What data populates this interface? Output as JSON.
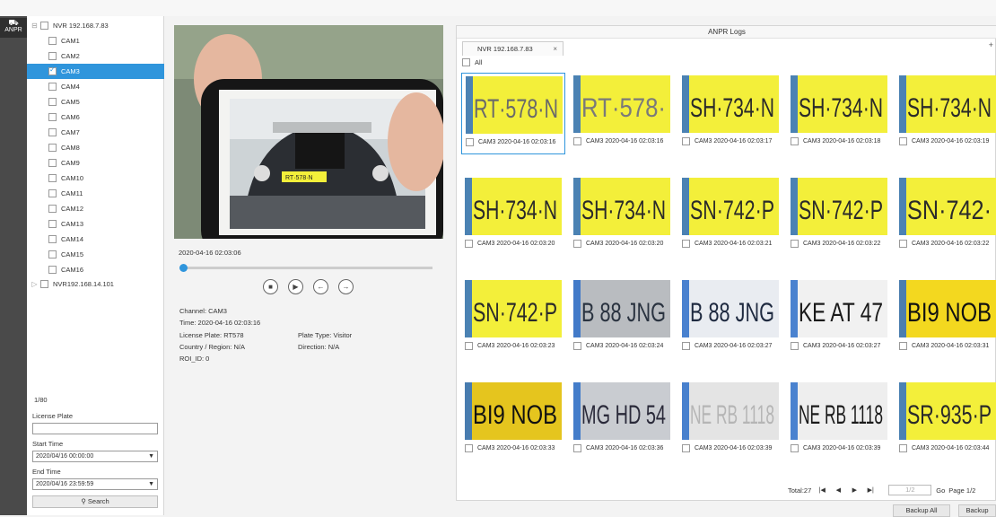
{
  "nav": {
    "label": "ANPR"
  },
  "tree": {
    "nvr1": "NVR 192.168.7.83",
    "cams": [
      "CAM1",
      "CAM2",
      "CAM3",
      "CAM4",
      "CAM5",
      "CAM6",
      "CAM7",
      "CAM8",
      "CAM9",
      "CAM10",
      "CAM11",
      "CAM12",
      "CAM13",
      "CAM14",
      "CAM15",
      "CAM16"
    ],
    "selected": "CAM3",
    "nvr2": "NVR192.168.14.101"
  },
  "pagination_left": "1/80",
  "search": {
    "plate_label": "License Plate",
    "plate_value": "",
    "start_label": "Start Time",
    "start_value": "2020/04/16 00:00:00",
    "end_label": "End Time",
    "end_value": "2020/04/16 23:59:59",
    "button": "Search"
  },
  "player": {
    "timestamp": "2020-04-16 02:03:06",
    "progress": 0.0
  },
  "details": {
    "channel": "Channel: CAM3",
    "time": "Time: 2020-04-16 02:03:16",
    "plate": "License Plate: RT578",
    "plate_type": "Plate Type: Visitor",
    "country": "Country / Region: N/A",
    "direction": "Direction: N/A",
    "roi": "ROI_ID: 0"
  },
  "logs": {
    "title": "ANPR Logs",
    "tab": "NVR 192.168.7.83",
    "all_label": "All",
    "items": [
      {
        "caption": "CAM3 2020-04-16 02:03:16",
        "plate": "RT·578·N",
        "bg": "#f3ef3a",
        "fg": "#6a6a6a"
      },
      {
        "caption": "CAM3 2020-04-16 02:03:16",
        "plate": "RT·578·",
        "bg": "#f3ef3a",
        "fg": "#7a7a7a"
      },
      {
        "caption": "CAM3 2020-04-16 02:03:17",
        "plate": "SH·734·N",
        "bg": "#f3ef3a",
        "fg": "#2a2a2a"
      },
      {
        "caption": "CAM3 2020-04-16 02:03:18",
        "plate": "SH·734·N",
        "bg": "#f3ef3a",
        "fg": "#2a2a2a"
      },
      {
        "caption": "CAM3 2020-04-16 02:03:19",
        "plate": "SH·734·N",
        "bg": "#f3ef3a",
        "fg": "#2a2a2a"
      },
      {
        "caption": "CAM3 2020-04-16 02:03:20",
        "plate": "SH·734·N",
        "bg": "#f3ef3a",
        "fg": "#2a2a2a"
      },
      {
        "caption": "CAM3 2020-04-16 02:03:20",
        "plate": "SH·734·N",
        "bg": "#f3ef3a",
        "fg": "#2a2a2a"
      },
      {
        "caption": "CAM3 2020-04-16 02:03:21",
        "plate": "SN·742·P",
        "bg": "#f3ef3a",
        "fg": "#2a2a2a"
      },
      {
        "caption": "CAM3 2020-04-16 02:03:22",
        "plate": "SN·742·P",
        "bg": "#f3ef3a",
        "fg": "#2a2a2a"
      },
      {
        "caption": "CAM3 2020-04-16 02:03:22",
        "plate": "SN·742·",
        "bg": "#f3ef3a",
        "fg": "#2a2a2a"
      },
      {
        "caption": "CAM3 2020-04-16 02:03:23",
        "plate": "SN·742·P",
        "bg": "#f3ef3a",
        "fg": "#2a2a2a"
      },
      {
        "caption": "CAM3 2020-04-16 02:03:24",
        "plate": "B 88 JNG",
        "bg": "#b9bcc0",
        "fg": "#2a3340"
      },
      {
        "caption": "CAM3 2020-04-16 02:03:27",
        "plate": "B 88 JNG",
        "bg": "#e9ecf1",
        "fg": "#1f2a40"
      },
      {
        "caption": "CAM3 2020-04-16 02:03:27",
        "plate": "KE AT 47",
        "bg": "#f1f1f1",
        "fg": "#1a1a1a"
      },
      {
        "caption": "CAM3 2020-04-16 02:03:31",
        "plate": "BI9 NOB",
        "bg": "#f3d81f",
        "fg": "#111111"
      },
      {
        "caption": "CAM3 2020-04-16 02:03:33",
        "plate": "BI9 NOB",
        "bg": "#e5c51e",
        "fg": "#111111"
      },
      {
        "caption": "CAM3 2020-04-16 02:03:36",
        "plate": "MG HD 54",
        "bg": "#c9ccd1",
        "fg": "#2a2a3a"
      },
      {
        "caption": "CAM3 2020-04-16 02:03:39",
        "plate": "NE RB 1118",
        "bg": "#e4e4e4",
        "fg": "#b5b5b5"
      },
      {
        "caption": "CAM3 2020-04-16 02:03:39",
        "plate": "NE RB 1118",
        "bg": "#eeeeee",
        "fg": "#1a1a1a"
      },
      {
        "caption": "CAM3 2020-04-16 02:03:44",
        "plate": "SR·935·P",
        "bg": "#f3ef3a",
        "fg": "#2a2a2a"
      }
    ],
    "total": "Total:27",
    "page_input": "1/2",
    "go": "Go",
    "page": "Page 1/2"
  },
  "buttons": {
    "backup_all": "Backup All",
    "backup": "Backup"
  },
  "colors": {
    "accent": "#2f95dc",
    "nav_bg": "#4a4a4a"
  }
}
